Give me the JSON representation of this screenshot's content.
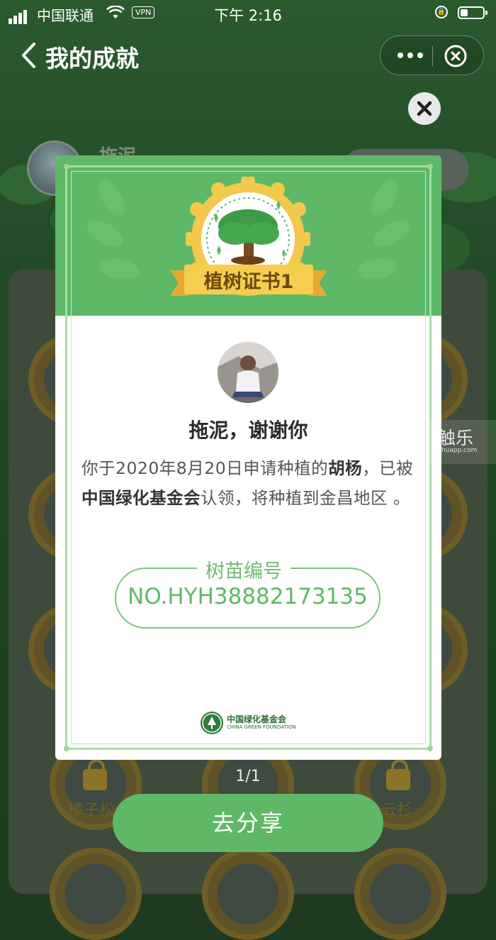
{
  "status_bar": {
    "carrier": "中国联通",
    "vpn": "VPN",
    "time": "下午 2:16"
  },
  "nav": {
    "title": "我的成就"
  },
  "background": {
    "profile_name": "拖泥",
    "medal_labels": [
      "樟子松",
      "云杉"
    ]
  },
  "certificate": {
    "badge_title": "植树证书1",
    "thanks": "拖泥，谢谢你",
    "message_parts": {
      "p1": "你于2020年8月20日申请种植的",
      "tree": "胡杨",
      "p2": "，已被",
      "org": "中国绿化基金会",
      "p3": "认领，将种植到金昌地区 。"
    },
    "seedling_label": "树苗编号",
    "seedling_number": "NO.HYH38882173135",
    "foundation_cn": "中国绿化基金会",
    "foundation_en": "CHINA GREEN FOUNDATION"
  },
  "pager": "1/1",
  "share_button": "去分享",
  "watermark": {
    "cn": "触乐",
    "en": "chuapp.com"
  },
  "colors": {
    "primary_green": "#5fb867",
    "badge_gold": "#f3c84b",
    "overlay_bg": "#1f3a22"
  }
}
